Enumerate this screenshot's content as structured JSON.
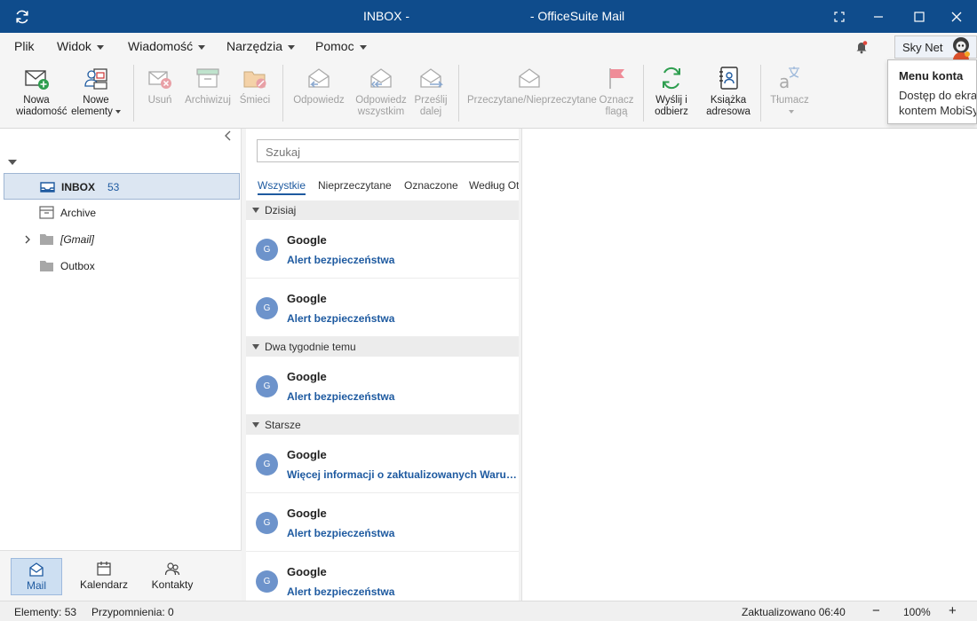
{
  "window": {
    "folder_title": "INBOX -",
    "app_title": "- OfficeSuite Mail"
  },
  "menu": {
    "items": [
      "Plik",
      "Widok",
      "Wiadomość",
      "Narzędzia",
      "Pomoc"
    ],
    "account_name": "Sky Net"
  },
  "ribbon": {
    "new_message": [
      "Nowa",
      "wiadomość"
    ],
    "new_items": [
      "Nowe",
      "elementy"
    ],
    "delete": "Usuń",
    "archive": "Archiwizuj",
    "junk": "Śmieci",
    "reply": "Odpowiedz",
    "reply_all": [
      "Odpowiedz",
      "wszystkim"
    ],
    "forward": [
      "Prześlij",
      "dalej"
    ],
    "read_unread": "Przeczytane/Nieprzeczytane",
    "flag": [
      "Oznacz",
      "flagą"
    ],
    "send_receive": [
      "Wyślij i",
      "odbierz"
    ],
    "address_book": [
      "Książka",
      "adresowa"
    ],
    "translator": "Tłumacz"
  },
  "tooltip": {
    "title": "Menu konta",
    "body_line1": "Dostęp do ekra",
    "body_line2": "kontem MobiSy"
  },
  "sidebar": {
    "folders": [
      {
        "name": "INBOX",
        "count": "53"
      },
      {
        "name": "Archive"
      },
      {
        "name": "[Gmail]"
      },
      {
        "name": "Outbox"
      }
    ],
    "nav": [
      "Mail",
      "Kalendarz",
      "Kontakty"
    ]
  },
  "message_list": {
    "search_placeholder": "Szukaj",
    "filter_tabs": [
      "Wszystkie",
      "Nieprzeczytane",
      "Oznaczone",
      "Według Otr"
    ],
    "groups": [
      "Dzisiaj",
      "Dwa tygodnie temu",
      "Starsze"
    ],
    "messages": [
      {
        "avatar": "G",
        "from": "Google",
        "subject": "Alert bezpieczeństwa"
      },
      {
        "avatar": "G",
        "from": "Google",
        "subject": "Alert bezpieczeństwa"
      },
      {
        "avatar": "G",
        "from": "Google",
        "subject": "Alert bezpieczeństwa"
      },
      {
        "avatar": "G",
        "from": "Google",
        "subject": "Więcej informacji o zaktualizowanych Warunkach"
      },
      {
        "avatar": "G",
        "from": "Google",
        "subject": "Alert bezpieczeństwa"
      },
      {
        "avatar": "G",
        "from": "Google",
        "subject": "Alert bezpieczeństwa"
      }
    ]
  },
  "status": {
    "items_count": "Elementy: 53",
    "reminders": "Przypomnienia: 0",
    "updated": "Zaktualizowano 06:40",
    "zoom": "100%",
    "zoom_minus": "−",
    "zoom_plus": "+"
  },
  "colors": {
    "titlebar": "#0f4c8c",
    "accent": "#1e5aa0",
    "selection": "#dce6f2",
    "avatar": "#6d93cb"
  }
}
